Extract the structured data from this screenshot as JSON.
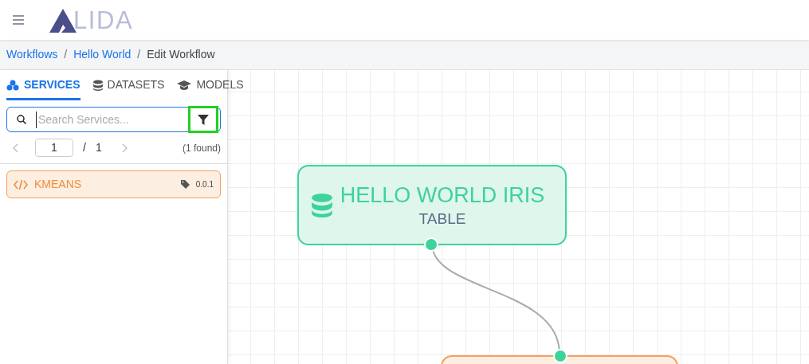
{
  "header": {
    "logo_text": "LIDA"
  },
  "breadcrumb": {
    "separator": "/",
    "items": [
      {
        "label": "Workflows",
        "link": true
      },
      {
        "label": "Hello World",
        "link": true
      },
      {
        "label": "Edit Workflow",
        "link": false
      }
    ]
  },
  "sidebar": {
    "tabs": [
      {
        "label": "SERVICES",
        "selected": true
      },
      {
        "label": "DATASETS",
        "selected": false
      },
      {
        "label": "MODELS",
        "selected": false
      }
    ],
    "search": {
      "placeholder": "Search Services...",
      "filter_highlighted": true
    },
    "pagination": {
      "page": "1",
      "separator": "/",
      "total": "1",
      "found": "(1 found)"
    },
    "items": [
      {
        "name": "KMEANS",
        "version": "0.0.1"
      }
    ]
  },
  "canvas": {
    "nodes": [
      {
        "kind": "dataset",
        "title": "HELLO WORLD IRIS",
        "subtitle": "TABLE"
      },
      {
        "kind": "service"
      }
    ]
  }
}
